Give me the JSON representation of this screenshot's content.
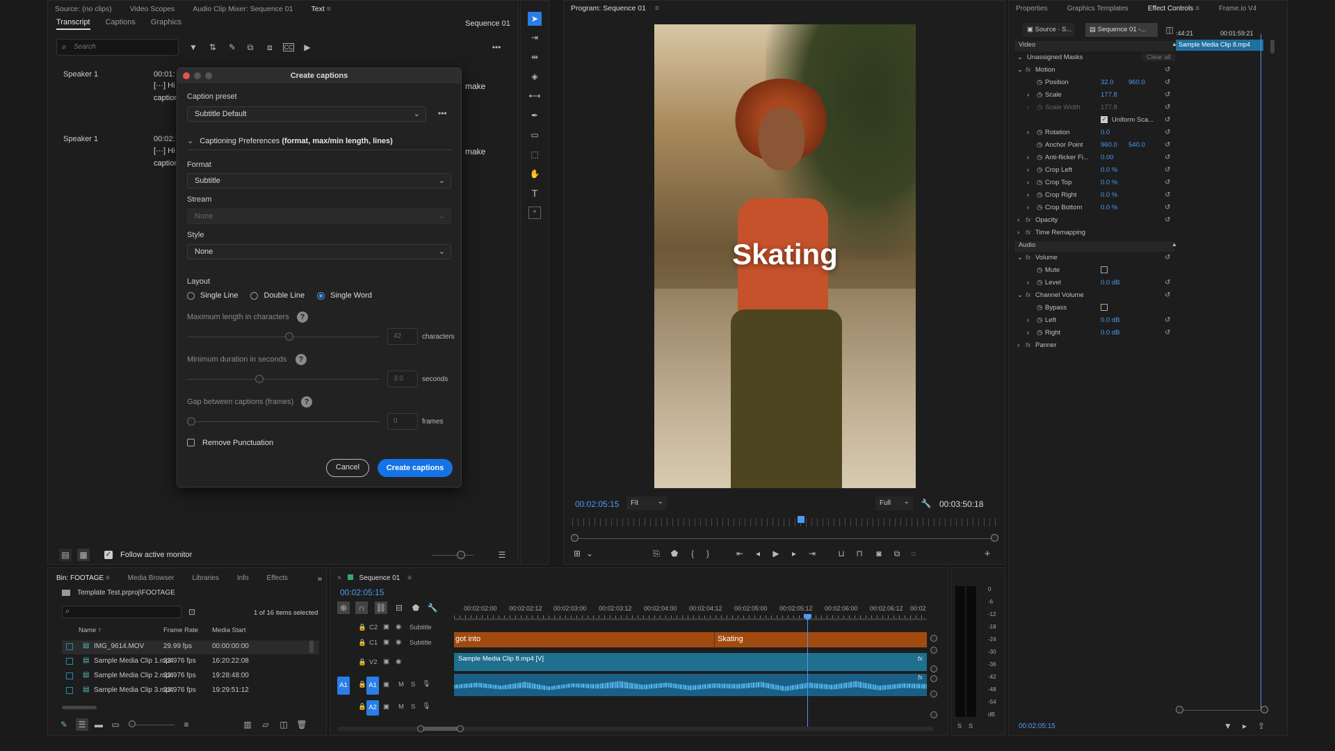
{
  "source_panel": {
    "tabs": [
      "Source: (no clips)",
      "Video Scopes",
      "Audio Clip Mixer: Sequence 01",
      "Text"
    ],
    "subtabs": [
      "Transcript",
      "Captions",
      "Graphics"
    ],
    "sequence_label": "Sequence 01",
    "search_placeholder": "Search",
    "speakers": [
      {
        "name": "Speaker 1",
        "time": "00:01:",
        "line1": "[···] Hi",
        "line2": "caption",
        "trailing": "make"
      },
      {
        "name": "Speaker 1",
        "time": "00:02:",
        "line1": "[···] Hi",
        "line2": "caption",
        "trailing": "make"
      }
    ],
    "follow_label": "Follow active monitor"
  },
  "dialog": {
    "title": "Create captions",
    "caption_preset_label": "Caption preset",
    "caption_preset_value": "Subtitle Default",
    "prefs_label": "Captioning Preferences",
    "prefs_hint": "(format, max/min length, lines)",
    "format_label": "Format",
    "format_value": "Subtitle",
    "stream_label": "Stream",
    "stream_value": "None",
    "style_label": "Style",
    "style_value": "None",
    "layout_label": "Layout",
    "layout_options": [
      "Single Line",
      "Double Line",
      "Single Word"
    ],
    "layout_selected": "Single Word",
    "max_length_label": "Maximum length in characters",
    "max_length_value": "42",
    "max_length_unit": "characters",
    "min_duration_label": "Minimum duration in seconds",
    "min_duration_value": "3.0",
    "min_duration_unit": "seconds",
    "gap_label": "Gap between captions (frames)",
    "gap_value": "0",
    "gap_unit": "frames",
    "remove_punct_label": "Remove Punctuation",
    "cancel_label": "Cancel",
    "create_label": "Create captions"
  },
  "program": {
    "title": "Program: Sequence 01",
    "caption_text": "Skating",
    "timecode": "00:02:05:15",
    "fit": "Fit",
    "quality": "Full",
    "duration": "00:03:50:18"
  },
  "effect_controls": {
    "tabs": [
      "Properties",
      "Graphics Templates",
      "Effect Controls",
      "Frame.io V4"
    ],
    "source_btn": "Source · S...",
    "sequence_btn": "Sequence 01 -...",
    "time_left": ":44:21",
    "time_right": "00:01:59:21",
    "clip_name": "Sample Media Clip 8.mp4",
    "video_label": "Video",
    "unassigned_masks": "Unassigned Masks",
    "clear_all": "Clear all",
    "motion": "Motion",
    "position": "Position",
    "position_x": "32.0",
    "position_y": "960.0",
    "scale": "Scale",
    "scale_v": "177.8",
    "scale_width": "Scale Width",
    "scale_width_v": "177.8",
    "uniform_scale": "Uniform Sca...",
    "rotation": "Rotation",
    "rotation_v": "0.0",
    "anchor_point": "Anchor Point",
    "anchor_x": "960.0",
    "anchor_y": "540.0",
    "anti_flicker": "Anti-flicker Fi...",
    "anti_flicker_v": "0.00",
    "crop_left": "Crop Left",
    "crop_left_v": "0.0 %",
    "crop_top": "Crop Top",
    "crop_top_v": "0.0 %",
    "crop_right": "Crop Right",
    "crop_right_v": "0.0 %",
    "crop_bottom": "Crop Bottom",
    "crop_bottom_v": "0.0 %",
    "opacity": "Opacity",
    "time_remapping": "Time Remapping",
    "audio_label": "Audio",
    "volume": "Volume",
    "mute": "Mute",
    "level": "Level",
    "level_v": "0.0 dB",
    "channel_volume": "Channel Volume",
    "bypass": "Bypass",
    "left": "Left",
    "left_v": "0.0 dB",
    "right": "Right",
    "right_v": "0.0 dB",
    "panner": "Panner",
    "footer_time": "00:02:05:15"
  },
  "bin": {
    "tabs": [
      "Bin: FOOTAGE",
      "Media Browser",
      "Libraries",
      "Info",
      "Effects"
    ],
    "path": "Template Test.prproj\\FOOTAGE",
    "selection": "1 of 16 items selected",
    "columns": [
      "Name",
      "Frame Rate",
      "Media Start"
    ],
    "rows": [
      {
        "name": "IMG_9614.MOV",
        "fps": "29.99 fps",
        "start": "00:00:00:00"
      },
      {
        "name": "Sample Media Clip 1.mp4",
        "fps": "23.976 fps",
        "start": "16:20:22:08"
      },
      {
        "name": "Sample Media Clip 2.mp4",
        "fps": "23.976 fps",
        "start": "19:28:48:00"
      },
      {
        "name": "Sample Media Clip 3.mp4",
        "fps": "23.976 fps",
        "start": "19:29:51:12"
      }
    ]
  },
  "timeline": {
    "title": "Sequence 01",
    "timecode": "00:02:05:15",
    "ruler": [
      "00:02:02:00",
      "00:02:02:12",
      "00:02:03:00",
      "00:02:03:12",
      "00:02:04:00",
      "00:02:04:12",
      "00:02:05:00",
      "00:02:05:12",
      "00:02:06:00",
      "00:02:06:12",
      "00:02"
    ],
    "tracks": {
      "c2": "C2",
      "c1": "C1",
      "subtitle": "Subtitle",
      "v2": "V2",
      "a1": "A1",
      "a2": "A2",
      "m": "M",
      "s": "S"
    },
    "caption_clips": [
      "got into",
      "Skating"
    ],
    "video_clip": "Sample Media Clip 8.mp4 [V]",
    "fx": "fx"
  },
  "meter": {
    "scale": [
      "0",
      "-6",
      "-12",
      "-18",
      "-24",
      "-30",
      "-36",
      "-42",
      "-48",
      "-54",
      "dB"
    ],
    "footer": [
      "S",
      "S"
    ]
  },
  "colors": {
    "accent": "#2b7de9",
    "caption_clip": "#a14a10",
    "video_clip": "#1f6f8f",
    "audio_clip": "#1a5f86"
  }
}
